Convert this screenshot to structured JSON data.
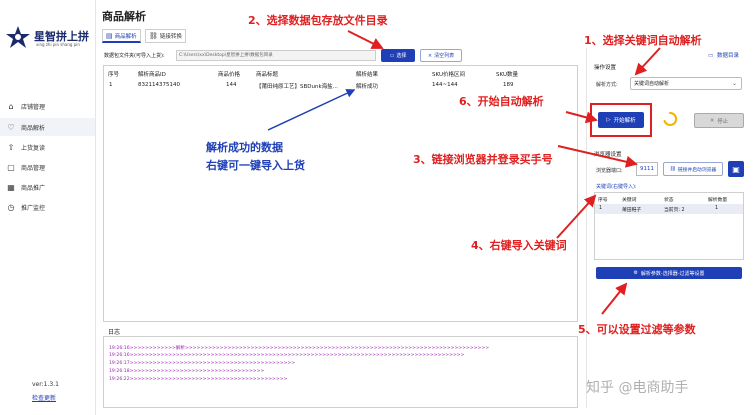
{
  "app": {
    "name": "星智拼上拼",
    "tagline": "xing zhi pin shang pin",
    "version": "ver:1.3.1",
    "check_update": "检查更新"
  },
  "sidebar": {
    "items": [
      {
        "label": "店铺管理",
        "icon": "home-icon"
      },
      {
        "label": "商品解析",
        "icon": "heart-icon",
        "active": true
      },
      {
        "label": "上货复读",
        "icon": "upload-icon"
      },
      {
        "label": "商品管理",
        "icon": "box-icon"
      },
      {
        "label": "商品推广",
        "icon": "grid-icon"
      },
      {
        "label": "推广监控",
        "icon": "clock-icon"
      }
    ]
  },
  "header": {
    "title": "商品解析",
    "tabs": [
      {
        "label": "商品解析",
        "active": true
      },
      {
        "label": "链接转换",
        "active": false
      }
    ]
  },
  "path": {
    "label": "数据包文件夹(可导入上货):",
    "value": "C:\\Users\\xx\\Desktop\\星智拼上拼\\数据包目录",
    "choose": "选择",
    "clear": "清空列表"
  },
  "table": {
    "columns": [
      "序号",
      "解析商品ID",
      "商品价格",
      "商品标题",
      "解析结果",
      "SKU价格区间",
      "SKU数量"
    ],
    "rows": [
      [
        "1",
        "832114375140",
        "144",
        "【莆田纯原工艺】SBDunk海盐...",
        "解析成功",
        "144~144",
        "189"
      ]
    ]
  },
  "log": {
    "title": "日志",
    "lines": [
      "19:26:16>>>>>>>>>>>>解析>>>>>>>>>>>>>>>>>>>>>>>>>>>>>>>>>>>>>>>>>>>>>>>>>>>>>>>>>>>>>>>>>>>>>>>>>>>>>>>",
      "19:26:16>>>>>>>>>>>>>>>>>>>>>>>>>>>>>>>>>>>>>>>>>>>>>>>>>>>>>>>>>>>>>>>>>>>>>>>>>>>>>>>>>>>>>>>",
      "19:26:17>>>>>>>>>>>>>>>>>>>>>>>>>>>>>>>>>>>>>>>>>>>",
      "19:26:18>>>>>>>>>>>>>>>>>>>>>>>>>>>>>>>>>>>",
      "19:26:22>>>>>>>>>>>>>>>>>>>>>>>>>>>>>>>>>>>>>>>>>"
    ]
  },
  "right_panel": {
    "data_dir": "数据目录",
    "op_settings": "操作设置",
    "parse_mode_label": "解析方式:",
    "parse_mode_value": "关键词自动解析",
    "start": "开始解析",
    "stop": "停止",
    "browser_section": "浏览器设置",
    "browser_port_label": "浏览器端口:",
    "browser_port": "9111",
    "connect": "链接并启动浏览器",
    "keywords_title": "关键词(右键导入):",
    "kw_columns": [
      "序号",
      "关键词",
      "状态",
      "解析数量"
    ],
    "kw_rows": [
      [
        "1",
        "莆田鞋子",
        "当前页: 2",
        "1"
      ]
    ],
    "filter_btn": "解析参数-选择器-过滤等设置"
  },
  "annotations": {
    "step1": "1、选择关键词自动解析",
    "step2": "2、选择数据包存放文件目录",
    "step3": "3、链接浏览器并登录买手号",
    "step4": "4、右键导入关键词",
    "step5": "5、可以设置过滤等参数",
    "step6": "6、开始自动解析",
    "note_line1": "解析成功的数据",
    "note_line2": "右键可一键导入上货",
    "color_red": "#e02020",
    "color_blue": "#1e3fb5"
  },
  "watermark": "知乎 @电商助手"
}
